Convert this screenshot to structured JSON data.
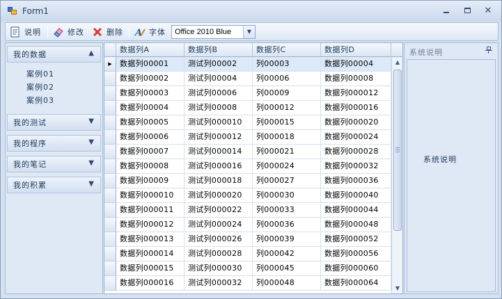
{
  "window": {
    "title": "Form1"
  },
  "toolbar": {
    "explain_label": "说明",
    "edit_label": "修改",
    "delete_label": "删除",
    "font_label": "字体",
    "theme_value": "Office 2010 Blue"
  },
  "nav": {
    "groups": [
      {
        "label": "我的数据",
        "expanded": true,
        "items": [
          "案例01",
          "案例02",
          "案例03"
        ]
      },
      {
        "label": "我的测试"
      },
      {
        "label": "我的程序"
      },
      {
        "label": "我的笔记"
      },
      {
        "label": "我的积累"
      }
    ]
  },
  "grid": {
    "columns": [
      "数据列A",
      "数据列B",
      "数据列C",
      "数据列D"
    ],
    "rows": [
      [
        "数据列00001",
        "测试列00002",
        "列00003",
        "数据列00004"
      ],
      [
        "数据列00002",
        "测试列00004",
        "列00006",
        "数据列00008"
      ],
      [
        "数据列00003",
        "测试列00006",
        "列00009",
        "数据列000012"
      ],
      [
        "数据列00004",
        "测试列00008",
        "列000012",
        "数据列000016"
      ],
      [
        "数据列00005",
        "测试列000010",
        "列000015",
        "数据列000020"
      ],
      [
        "数据列00006",
        "测试列000012",
        "列000018",
        "数据列000024"
      ],
      [
        "数据列00007",
        "测试列000014",
        "列000021",
        "数据列000028"
      ],
      [
        "数据列00008",
        "测试列000016",
        "列000024",
        "数据列000032"
      ],
      [
        "数据列00009",
        "测试列000018",
        "列000027",
        "数据列000036"
      ],
      [
        "数据列000010",
        "测试列000020",
        "列000030",
        "数据列000040"
      ],
      [
        "数据列000011",
        "测试列000022",
        "列000033",
        "数据列000044"
      ],
      [
        "数据列000012",
        "测试列000024",
        "列000036",
        "数据列000048"
      ],
      [
        "数据列000013",
        "测试列000026",
        "列000039",
        "数据列000052"
      ],
      [
        "数据列000014",
        "测试列000028",
        "列000042",
        "数据列000056"
      ],
      [
        "数据列000015",
        "测试列000030",
        "列000045",
        "数据列000060"
      ],
      [
        "数据列000016",
        "测试列000032",
        "列000048",
        "数据列000064"
      ]
    ],
    "selected_row": 0
  },
  "dock": {
    "caption": "系统说明",
    "content": "系统说明"
  },
  "colors": {
    "accent": "#1e395b",
    "selection": "#dce9f8",
    "frame": "#d5e1f0"
  }
}
